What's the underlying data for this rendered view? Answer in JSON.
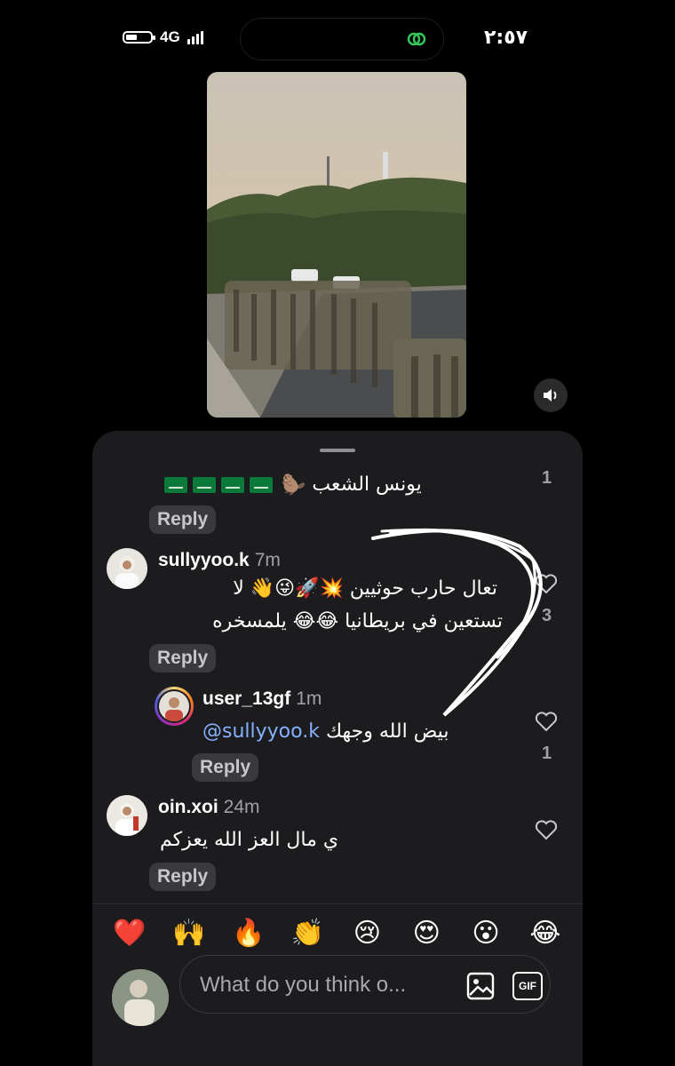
{
  "status": {
    "network": "4G",
    "time": "٢:٥٧"
  },
  "comments": {
    "partial": {
      "text": "يونس الشعب",
      "likes": "1"
    },
    "c1": {
      "username": "sullyyoo.k",
      "time": "7m",
      "line1": "تعال حارب حوثيين 💥🚀😜👋 لا",
      "line2": "تستعين في بريطانيا 😂😂 يلمسخره",
      "likes": "3"
    },
    "c2": {
      "username": "user_13gf",
      "time": "1m",
      "mention": "@sullyyoo.k",
      "text": "بيض الله وجهك",
      "likes": "1"
    },
    "c3": {
      "username": "oin.xoi",
      "time": "24m",
      "text": "ي مال العز الله يعزكم"
    },
    "reply_label": "Reply"
  },
  "reactions": [
    "❤️",
    "🙌",
    "🔥",
    "👏",
    "😢",
    "😍",
    "😮",
    "😂"
  ],
  "composer": {
    "placeholder": "What do you think o...",
    "gif_label": "GIF"
  }
}
